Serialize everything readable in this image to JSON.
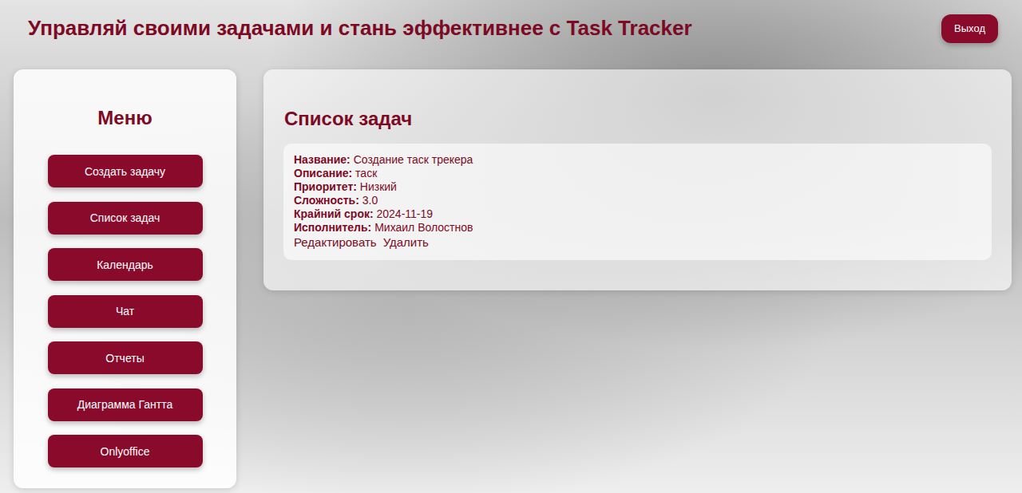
{
  "header": {
    "title": "Управляй своими задачами и стань эффективнее с Task Tracker",
    "logout": "Выход"
  },
  "menu": {
    "title": "Меню",
    "items": [
      {
        "label": "Создать задачу",
        "selected": false
      },
      {
        "label": "Список задач",
        "selected": false
      },
      {
        "label": "Календарь",
        "selected": false
      },
      {
        "label": "Чат",
        "selected": false
      },
      {
        "label": "Отчеты",
        "selected": false
      },
      {
        "label": "Диаграмма Гантта",
        "selected": false
      },
      {
        "label": "Onlyoffice",
        "selected": false
      }
    ]
  },
  "tasks": {
    "title": "Список задач",
    "items": [
      {
        "fields": [
          {
            "label": "Название:",
            "value": "Создание таск трекера"
          },
          {
            "label": "Описание:",
            "value": "таск"
          },
          {
            "label": "Приоритет:",
            "value": "Низкий"
          },
          {
            "label": "Сложность:",
            "value": "3.0"
          },
          {
            "label": "Крайний срок:",
            "value": "2024-11-19"
          },
          {
            "label": "Исполнитель:",
            "value": "Михаил Волостнов"
          }
        ],
        "actions": [
          "Редактировать",
          "Удалить"
        ]
      }
    ]
  }
}
